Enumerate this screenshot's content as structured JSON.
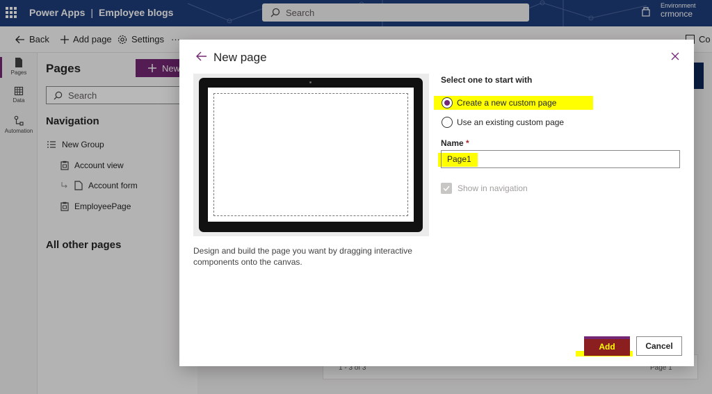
{
  "app": {
    "product": "Power Apps",
    "app_name": "Employee blogs",
    "search_placeholder": "Search",
    "environment_label": "Environment",
    "environment_value": "crmonce"
  },
  "commandbar": {
    "back": "Back",
    "add_page": "Add page",
    "settings": "Settings",
    "more": "···",
    "right_partial": "Co"
  },
  "rail": {
    "items": [
      {
        "label": "Pages",
        "icon": "page-icon"
      },
      {
        "label": "Data",
        "icon": "table-icon"
      },
      {
        "label": "Automation",
        "icon": "flow-icon"
      }
    ]
  },
  "pages_panel": {
    "title": "Pages",
    "new_button": "New",
    "search_placeholder": "Search",
    "navigation_title": "Navigation",
    "group": "New Group",
    "items": [
      "Account view",
      "Account form",
      "EmployeePage"
    ],
    "other_title": "All other pages"
  },
  "background": {
    "pager_count": "1 - 3 of 3",
    "pager_page": "Page 1"
  },
  "dialog": {
    "title": "New page",
    "description": "Design and build the page you want by dragging interactive components onto the canvas.",
    "select_label": "Select one to start with",
    "options": [
      {
        "label": "Create a new custom page",
        "selected": true
      },
      {
        "label": "Use an existing custom page",
        "selected": false
      }
    ],
    "name_label": "Name",
    "name_required": "*",
    "name_value": "Page1",
    "show_in_nav": "Show in navigation",
    "show_in_nav_checked": true,
    "add_button": "Add",
    "cancel_button": "Cancel"
  },
  "colors": {
    "accent": "#742774",
    "topbar": "#1f3d7a",
    "highlight": "#ffff00"
  }
}
